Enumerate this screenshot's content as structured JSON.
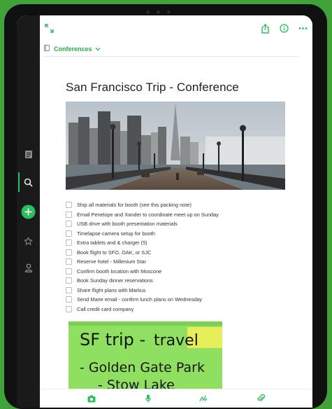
{
  "note": {
    "notebook": "Conferences",
    "title": "San Francisco Trip - Conference",
    "checklist": [
      "Ship all materials for booth (see this packing note)",
      "Email Penelope and Xander to coordinate meet up on Sunday",
      "USB drive with booth presentation materials",
      "Timelapse camera setup for booth",
      "Extra tablets and & charger (5)",
      "Book flight to SFO, OAK, or SJC",
      "Reserve hotel - Millenium Star",
      "Confirm booth location with Moscone",
      "Book Sunday dinner reservations",
      "Share flight plans with Markus",
      "Send Marie email - confirm lunch plans on Wednesday",
      "Call credit card company"
    ],
    "handwritten": {
      "line1": "SF trip -",
      "tag": "travel",
      "line2": "- Golden Gate Park",
      "line3": "- Stow Lake"
    }
  },
  "icons": {
    "rail": [
      "notes-icon",
      "search-icon",
      "new-note-icon",
      "shortcuts-star-icon",
      "account-icon"
    ],
    "top": [
      "expand-icon",
      "share-icon",
      "info-icon",
      "more-icon"
    ],
    "bottom": [
      "camera-icon",
      "microphone-icon",
      "handwriting-icon",
      "attachment-icon"
    ]
  },
  "colors": {
    "accent": "#2dbe60",
    "background": "#3fa33a",
    "rail": "#1a1a1a"
  }
}
